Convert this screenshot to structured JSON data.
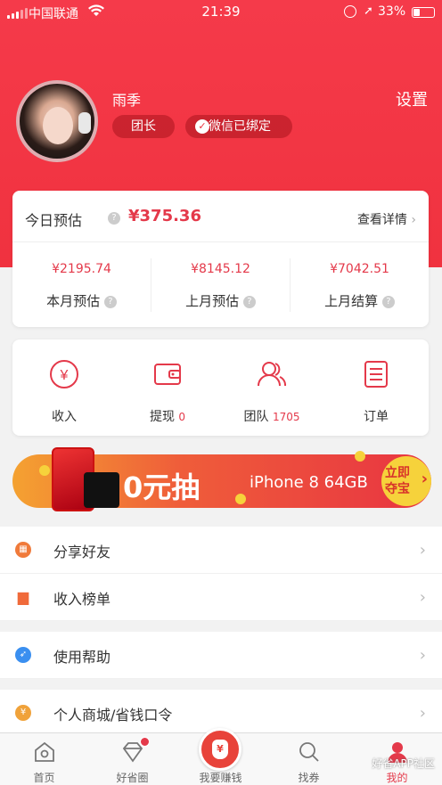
{
  "status_bar": {
    "carrier": "中国联通",
    "time": "21:39",
    "battery": "33%"
  },
  "profile": {
    "name": "雨季",
    "settings_label": "设置",
    "role_badge": "团长",
    "wechat_badge": "微信已绑定"
  },
  "earnings": {
    "today_label": "今日预估",
    "today_value": "¥375.36",
    "detail_link": "查看详情",
    "stats": [
      {
        "value": "¥2195.74",
        "label": "本月预估"
      },
      {
        "value": "¥8145.12",
        "label": "上月预估"
      },
      {
        "value": "¥7042.51",
        "label": "上月结算"
      }
    ]
  },
  "actions": [
    {
      "label": "收入",
      "count": ""
    },
    {
      "label": "提现",
      "count": "0"
    },
    {
      "label": "团队",
      "count": "1705"
    },
    {
      "label": "订单",
      "count": ""
    }
  ],
  "banner": {
    "headline": "0元抽",
    "prize": "iPhone 8 64GB",
    "cta_line1": "立即",
    "cta_line2": "夺宝"
  },
  "menu": {
    "group1": [
      {
        "label": "分享好友",
        "icon_color": "#f07a3a"
      },
      {
        "label": "收入榜单",
        "icon_color": "#f06a3a"
      }
    ],
    "group2": [
      {
        "label": "使用帮助",
        "icon_color": "#3a8ff0"
      }
    ],
    "group3": [
      {
        "label": "个人商城/省钱口令",
        "icon_color": "#f0a23a"
      }
    ]
  },
  "tabs": [
    {
      "label": "首页"
    },
    {
      "label": "好省圈"
    },
    {
      "label": "我要赚钱"
    },
    {
      "label": "找券"
    },
    {
      "label": "我的"
    }
  ],
  "watermark": "好省APP社区",
  "colors": {
    "brand_red": "#f0323f",
    "price_red": "#e4394a"
  }
}
